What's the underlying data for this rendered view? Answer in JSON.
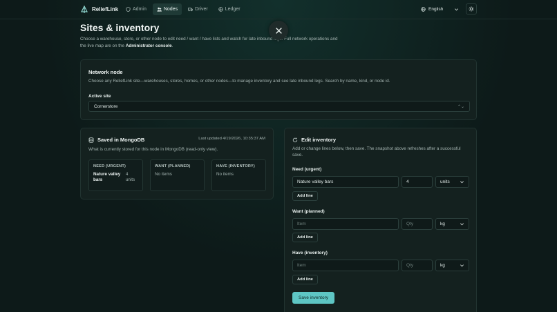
{
  "brand": {
    "name": "ReliefLink",
    "icon": "relief-tree-icon"
  },
  "nav": [
    {
      "label": "Admin",
      "icon": "shield-icon",
      "active": false
    },
    {
      "label": "Nodes",
      "icon": "people-icon",
      "active": true
    },
    {
      "label": "Driver",
      "icon": "truck-icon",
      "active": false
    },
    {
      "label": "Ledger",
      "icon": "ledger-icon",
      "active": false
    }
  ],
  "language": {
    "value": "English",
    "icon": "globe-icon"
  },
  "theme_toggle": {
    "icon": "sun-icon"
  },
  "page": {
    "title": "Sites & inventory",
    "desc_pre": "Choose a warehouse, store, or other node to edit need / want / have lists and watch for late inbound legs. Full network operations and the live map are on the ",
    "desc_link": "Administrator console",
    "desc_post": "."
  },
  "network_node": {
    "heading": "Network node",
    "description": "Choose any ReliefLink site—warehouses, stores, homes, or other nodes—to manage inventory and see late inbound legs. Search by name, kind, or node id.",
    "active_site_label": "Active site",
    "active_site_value": "Cornerstore"
  },
  "saved": {
    "heading": "Saved in MongoDB",
    "updated": "Last updated 4/19/2026, 10:35:37 AM",
    "description": "What is currently stored for this node in MongoDB (read-only view).",
    "columns": [
      {
        "title": "NEED (URGENT)",
        "item": "Nature valley bars",
        "qty": "4 units"
      },
      {
        "title": "WANT (PLANNED)",
        "empty": "No items"
      },
      {
        "title": "HAVE (INVENTORY)",
        "empty": "No items"
      }
    ]
  },
  "edit": {
    "heading": "Edit inventory",
    "description": "Add or change lines below, then save. The snapshot above refreshes after a successful save.",
    "item_placeholder": "Item",
    "qty_placeholder": "Qty",
    "add_line": "Add line",
    "need": {
      "label": "Need (urgent)",
      "item": "Nature valley bars",
      "qty": "4",
      "unit": "units"
    },
    "want": {
      "label": "Want (planned)",
      "unit": "kg"
    },
    "have": {
      "label": "Have (inventory)",
      "unit": "kg"
    },
    "save": "Save inventory"
  },
  "colors": {
    "accent": "#5ec6c4",
    "background": "#0d1a19",
    "card": "#14211f"
  }
}
